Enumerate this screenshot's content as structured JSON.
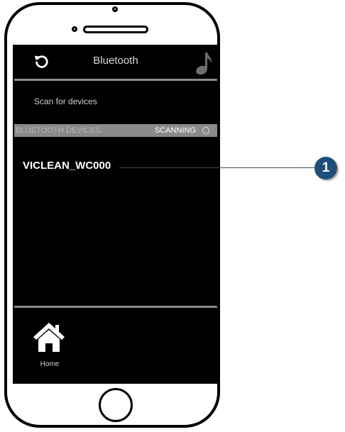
{
  "header": {
    "title": "Bluetooth",
    "back_icon": "refresh-back-icon",
    "right_icon": "music-note-icon"
  },
  "scan": {
    "label": "Scan for devices"
  },
  "section": {
    "title": "BLUETOOTH DEVICES",
    "status": "SCANNING",
    "status_icon": "circle-outline-icon"
  },
  "devices": [
    {
      "name": "VICLEAN_WC000"
    }
  ],
  "footer": {
    "home_label": "Home",
    "home_icon": "home-icon"
  },
  "callout": {
    "number": "1",
    "color": "#1f4e79"
  },
  "colors": {
    "screen_bg": "#000000",
    "section_bar": "#8a8a8a",
    "divider": "#8c8c8c"
  }
}
